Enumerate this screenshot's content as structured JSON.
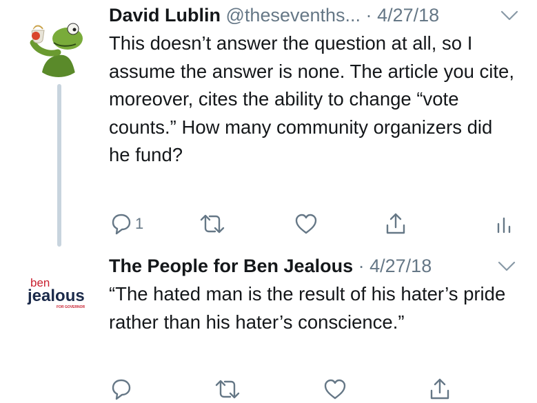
{
  "tweets": [
    {
      "name": "David Lublin",
      "handle": "@thesevenths...",
      "separator": "·",
      "date": "4/27/18",
      "text": "This doesn’t answer the question at all, so I assume the answer is none. The article you cite, moreover, cites the ability to change “vote counts.” How many community organizers did he fund?",
      "reply_count": "1",
      "avatar_icon": "kermit-sipping-tea-avatar"
    },
    {
      "name": "The People for Ben Jealous",
      "separator": "·",
      "date": "4/27/18",
      "text": "“The hated man is the result of his hater’s pride rather than his hater’s conscience.”",
      "logo": {
        "line1": "ben",
        "line2": "jealous",
        "line3": "FOR GOVERNOR",
        "color_red": "#c8202f",
        "color_navy": "#1b2a4a"
      }
    }
  ],
  "colors": {
    "text": "#14171a",
    "secondary": "#657786",
    "thread_line": "#c8d4de"
  }
}
